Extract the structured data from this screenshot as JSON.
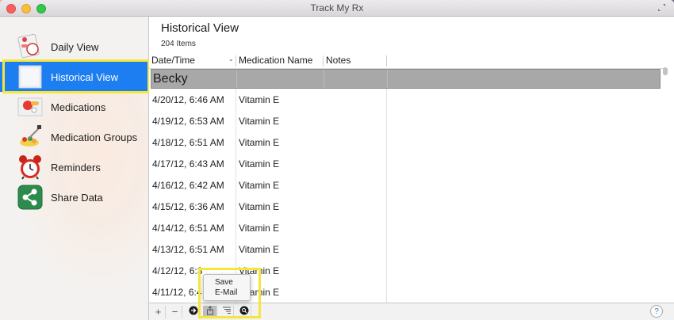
{
  "window": {
    "title": "Track My Rx"
  },
  "sidebar": {
    "items": [
      {
        "label": "Daily View",
        "icon": "pill-calendar-icon"
      },
      {
        "label": "Historical View",
        "icon": "calendar-pages-icon",
        "selected": true
      },
      {
        "label": "Medications",
        "icon": "pills-icon"
      },
      {
        "label": "Medication Groups",
        "icon": "medication-group-icon"
      },
      {
        "label": "Reminders",
        "icon": "alarm-clock-icon"
      },
      {
        "label": "Share Data",
        "icon": "share-icon"
      }
    ]
  },
  "main": {
    "title": "Historical View",
    "count": "204 Items",
    "columns": [
      "Date/Time",
      "Medication Name",
      "Notes"
    ],
    "group": "Becky",
    "rows": [
      {
        "date": "4/20/12, 6:46 AM",
        "medication": "Vitamin E"
      },
      {
        "date": "4/19/12, 6:53 AM",
        "medication": "Vitamin E"
      },
      {
        "date": "4/18/12, 6:51 AM",
        "medication": "Vitamin E"
      },
      {
        "date": "4/17/12, 6:43 AM",
        "medication": "Vitamin E"
      },
      {
        "date": "4/16/12, 6:42 AM",
        "medication": "Vitamin E"
      },
      {
        "date": "4/15/12, 6:36 AM",
        "medication": "Vitamin E"
      },
      {
        "date": "4/14/12, 6:51 AM",
        "medication": "Vitamin E"
      },
      {
        "date": "4/13/12, 6:51 AM",
        "medication": "Vitamin E"
      },
      {
        "date": "4/12/12, 6:3",
        "medication": "Vitamin E"
      },
      {
        "date": "4/11/12, 6:4",
        "medication": "Vitamin E"
      }
    ]
  },
  "bottombar": {
    "add_label": "+",
    "remove_label": "−",
    "help_label": "?"
  },
  "popup": {
    "items": [
      "Save",
      "E-Mail"
    ]
  },
  "colors": {
    "selection": "#1c7ef0",
    "highlight": "#f6e63a",
    "group_row": "#a8a8a8"
  }
}
